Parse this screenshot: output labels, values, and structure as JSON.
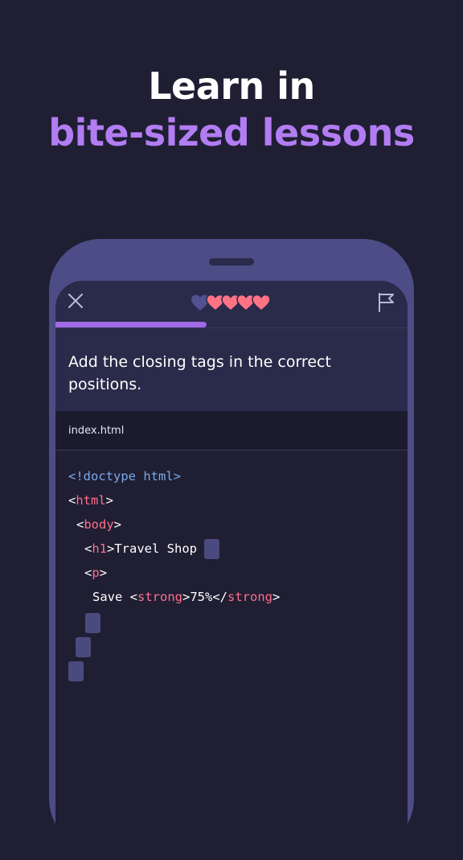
{
  "headline": {
    "line1": "Learn in",
    "line2": "bite-sized lessons"
  },
  "lesson": {
    "hearts": {
      "filled": 4,
      "total": 5
    },
    "progress": 0.43,
    "instruction": "Add the closing tags in the correct positions.",
    "file_name": "index.html"
  },
  "code": {
    "l1": "<!doctype html>",
    "l2_lt": "<",
    "l2_tag": "html",
    "l2_gt": ">",
    "l3_lt": "<",
    "l3_tag": "body",
    "l3_gt": ">",
    "l4_lt": "<",
    "l4_tag": "h1",
    "l4_text": ">Travel Shop ",
    "l5_lt": "<",
    "l5_tag": "p",
    "l5_gt": ">",
    "l6_text": "Save <",
    "l6_tag": "strong",
    "l6_mid": ">75%</",
    "l6_tag2": "strong",
    "l6_gt": ">"
  },
  "colors": {
    "background": "#1f1e33",
    "accent": "#b27cf2",
    "heart": "#ff7385",
    "heart_empty": "#4f5190",
    "tag": "#ff6f8c",
    "doctype": "#7aa9e8"
  },
  "icons": {
    "close": "close-icon",
    "flag": "flag-icon",
    "heart": "heart-icon"
  }
}
